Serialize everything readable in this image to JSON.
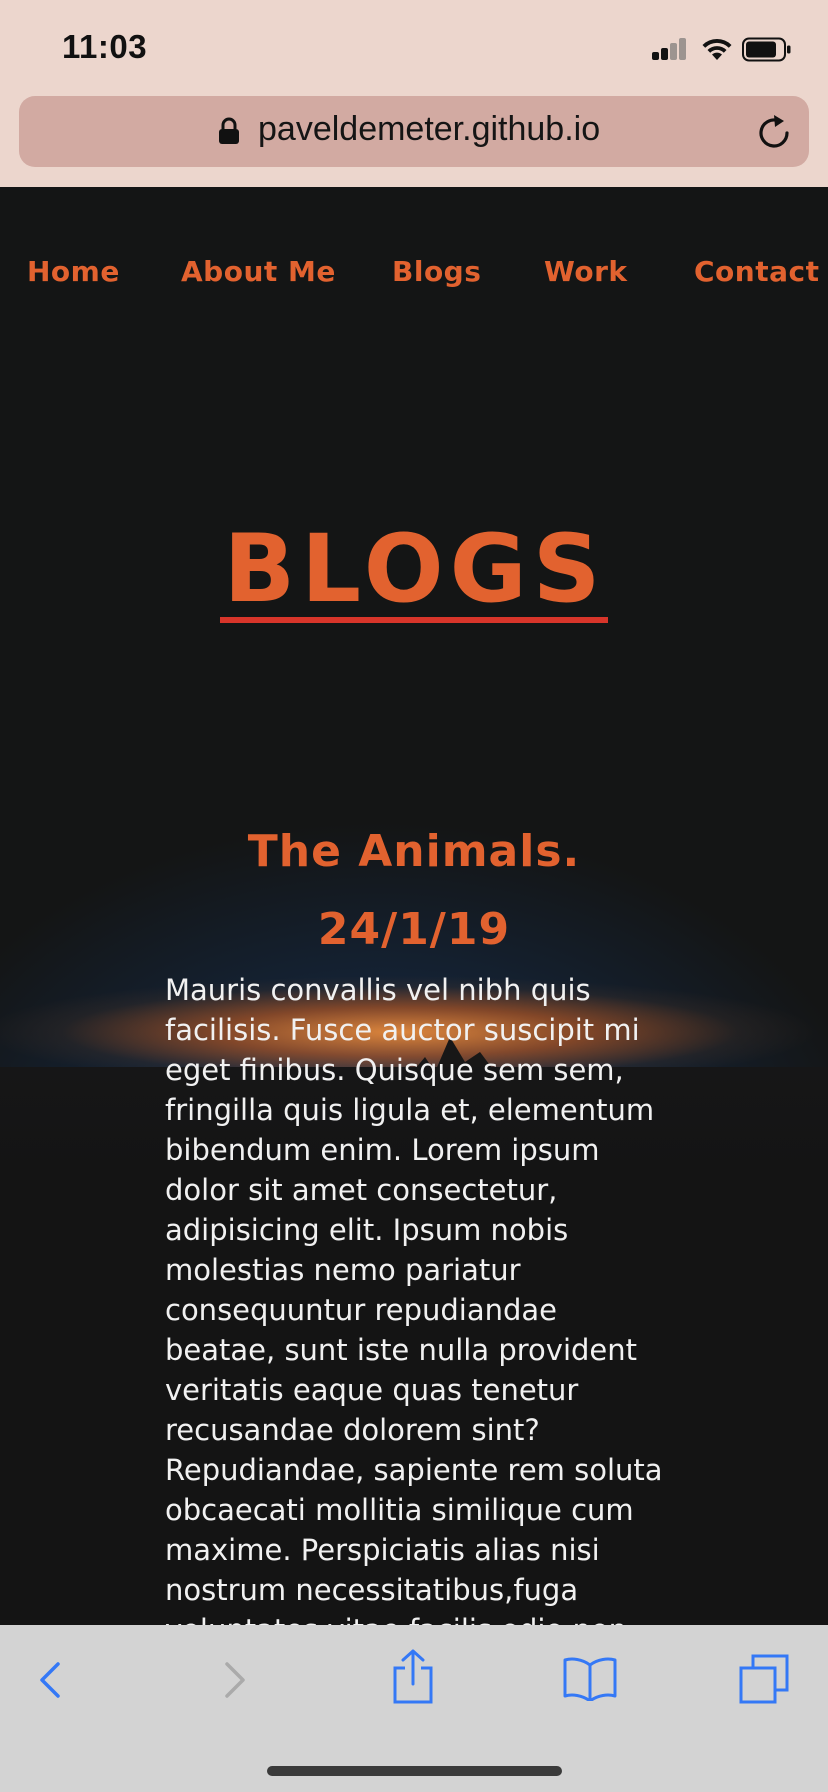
{
  "status_bar": {
    "time": "11:03"
  },
  "browser": {
    "url": "paveldemeter.github.io"
  },
  "nav": {
    "items": [
      "Home",
      "About Me",
      "Blogs",
      "Work",
      "Contact"
    ]
  },
  "page": {
    "title": "BLOGS"
  },
  "post": {
    "title": "The Animals.",
    "date": "24/1/19",
    "body": "Mauris convallis vel nibh quis facilisis. Fusce auctor suscipit mi eget finibus. Quisque sem sem, fringilla quis ligula et, elementum bibendum enim. Lorem ipsum dolor sit amet consectetur, adipisicing elit. Ipsum nobis molestias nemo pariatur consequuntur repudiandae beatae, sunt iste nulla provident veritatis eaque quas tenetur recusandae dolorem sint? Repudiandae, sapiente rem soluta obcaecati mollitia similique cum maxime. Perspiciatis alias nisi nostrum necessitatibus,fuga voluptates vitae facilis odio non"
  },
  "colors": {
    "accent": "#e2622f",
    "underline": "#d8352a",
    "ios_blue": "#3478f6"
  },
  "toolbar": {
    "icons": [
      "back-icon",
      "forward-icon",
      "share-icon",
      "bookmarks-icon",
      "tabs-icon"
    ]
  }
}
